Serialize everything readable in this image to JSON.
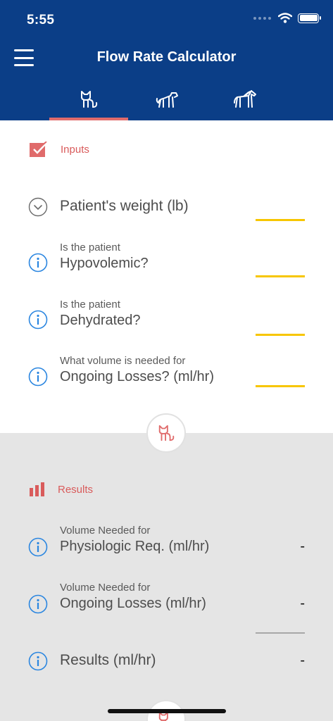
{
  "status": {
    "time": "5:55"
  },
  "header": {
    "title": "Flow Rate Calculator"
  },
  "tabs": [
    {
      "icon": "cat-icon",
      "selected": true
    },
    {
      "icon": "dog-icon",
      "selected": false
    },
    {
      "icon": "horse-icon",
      "selected": false
    }
  ],
  "inputs": {
    "label": "Inputs",
    "weight": {
      "label": "Patient's weight (lb)"
    },
    "hypovolemic": {
      "sub": "Is the patient",
      "main": "Hypovolemic?"
    },
    "dehydrated": {
      "sub": "Is the patient",
      "main": "Dehydrated?"
    },
    "ongoing": {
      "sub": "What volume is needed for",
      "main": "Ongoing Losses? (ml/hr)"
    }
  },
  "results": {
    "label": "Results",
    "physiologic": {
      "sub": "Volume Needed for",
      "main": "Physiologic Req. (ml/hr)",
      "value": "-"
    },
    "ongoing": {
      "sub": "Volume Needed for",
      "main": "Ongoing Losses (ml/hr)",
      "value": "-"
    },
    "total": {
      "main": "Results (ml/hr)",
      "value": "-"
    }
  },
  "colors": {
    "header": "#0b3e87",
    "accent": "#e06b6b",
    "input_line": "#f7c600",
    "info": "#2b86e0",
    "results_bg": "#e5e5e5"
  }
}
